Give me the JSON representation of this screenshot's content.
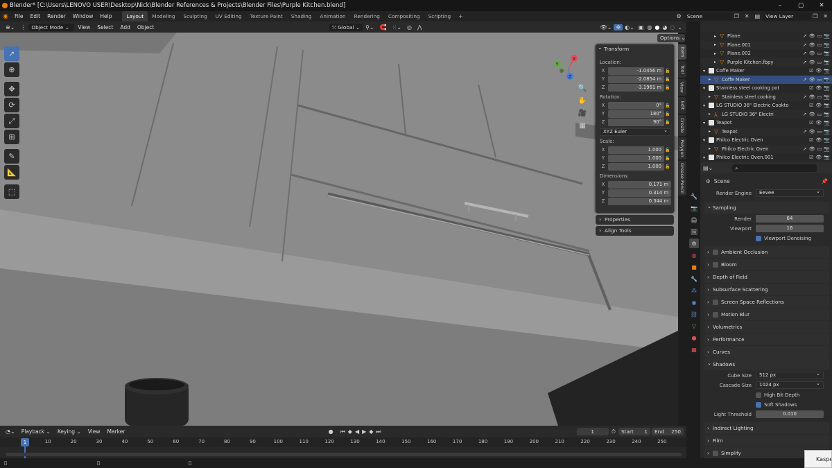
{
  "window": {
    "title": "Blender* [C:\\Users\\LENOVO USER\\Desktop\\Nick\\Blender References & Projects\\Blender Files\\Purple Kitchen.blend]"
  },
  "menu": {
    "items": [
      "File",
      "Edit",
      "Render",
      "Window",
      "Help"
    ]
  },
  "workspaces": [
    "Layout",
    "Modeling",
    "Sculpting",
    "UV Editing",
    "Texture Paint",
    "Shading",
    "Animation",
    "Rendering",
    "Compositing",
    "Scripting"
  ],
  "active_workspace": "Layout",
  "scene": {
    "name": "Scene",
    "view_layer": "View Layer"
  },
  "viewport_header": {
    "mode": "Object Mode",
    "menus": [
      "View",
      "Select",
      "Add",
      "Object"
    ],
    "orientation": "Global",
    "options": "Options"
  },
  "transform": {
    "title": "Transform",
    "location_label": "Location:",
    "location": {
      "x": "-1.0456 m",
      "y": "-2.0854 m",
      "z": "-3.1961 m"
    },
    "rotation_label": "Rotation:",
    "rotation": {
      "x": "0°",
      "y": "180°",
      "z": "90°"
    },
    "rotation_mode": "XYZ Euler",
    "scale_label": "Scale:",
    "scale": {
      "x": "1.000",
      "y": "1.000",
      "z": "1.000"
    },
    "dimensions_label": "Dimensions:",
    "dimensions": {
      "x": "0.171 m",
      "y": "0.314 m",
      "z": "0.344 m"
    },
    "axes": [
      "X",
      "Y",
      "Z"
    ]
  },
  "npanel_sections": [
    "Properties",
    "Align Tools"
  ],
  "side_tabs": [
    "Item",
    "Tool",
    "View",
    "Edit",
    "Create",
    "Polygon",
    "Grease Pencil"
  ],
  "outliner": {
    "rows": [
      {
        "label": "Plane",
        "indent": 2,
        "type": "mesh",
        "selected": false
      },
      {
        "label": "Plane.001",
        "indent": 2,
        "type": "mesh",
        "selected": false
      },
      {
        "label": "Plane.002",
        "indent": 2,
        "type": "mesh",
        "selected": false
      },
      {
        "label": "Purple Kitchen.fbpy",
        "indent": 2,
        "type": "mesh",
        "selected": false
      },
      {
        "label": "Coffe Maker",
        "indent": 0,
        "type": "collection",
        "selected": false
      },
      {
        "label": "Coffe Maker",
        "indent": 1,
        "type": "mesh",
        "selected": true
      },
      {
        "label": "Stainless steel cooking pot",
        "indent": 0,
        "type": "collection",
        "selected": false
      },
      {
        "label": "Stainless steel cooking",
        "indent": 1,
        "type": "mesh",
        "selected": false
      },
      {
        "label": "LG STUDIO 36\" Electric Cookto",
        "indent": 0,
        "type": "collection",
        "selected": false
      },
      {
        "label": "LG STUDIO 36\" Electri",
        "indent": 1,
        "type": "empty",
        "selected": false
      },
      {
        "label": "Teapot",
        "indent": 0,
        "type": "collection",
        "selected": false
      },
      {
        "label": "Teapot",
        "indent": 1,
        "type": "mesh",
        "selected": false
      },
      {
        "label": "Philco Electric Oven",
        "indent": 0,
        "type": "collection",
        "selected": false
      },
      {
        "label": "Philco Electric Oven",
        "indent": 1,
        "type": "mesh",
        "selected": false
      },
      {
        "label": "Philco Electric Oven.001",
        "indent": 0,
        "type": "collection",
        "selected": false
      }
    ]
  },
  "properties": {
    "context": "Scene",
    "render_engine_label": "Render Engine",
    "render_engine": "Eevee",
    "sampling": {
      "title": "Sampling",
      "render_label": "Render",
      "render": "64",
      "viewport_label": "Viewport",
      "viewport": "16",
      "denoise_label": "Viewport Denoising",
      "denoise_on": true
    },
    "sections_mid": [
      {
        "label": "Ambient Occlusion",
        "checkbox": true
      },
      {
        "label": "Bloom",
        "checkbox": true
      },
      {
        "label": "Depth of Field",
        "checkbox": false
      },
      {
        "label": "Subsurface Scattering",
        "checkbox": false
      },
      {
        "label": "Screen Space Reflections",
        "checkbox": true
      },
      {
        "label": "Motion Blur",
        "checkbox": true
      },
      {
        "label": "Volumetrics",
        "checkbox": false
      },
      {
        "label": "Performance",
        "checkbox": false
      },
      {
        "label": "Curves",
        "checkbox": false
      }
    ],
    "shadows": {
      "title": "Shadows",
      "cube_size_label": "Cube Size",
      "cube_size": "512 px",
      "cascade_size_label": "Cascade Size",
      "cascade_size": "1024 px",
      "high_bit_depth_label": "High Bit Depth",
      "high_bit_depth": false,
      "soft_shadows_label": "Soft Shadows",
      "soft_shadows": true,
      "light_threshold_label": "Light Threshold",
      "light_threshold": "0.010"
    },
    "sections_bottom": [
      {
        "label": "Indirect Lighting",
        "checkbox": false
      },
      {
        "label": "Film",
        "checkbox": false
      },
      {
        "label": "Simplify",
        "checkbox": true
      }
    ]
  },
  "timeline": {
    "menus": [
      "Playback",
      "Keying",
      "View",
      "Marker"
    ],
    "current_frame": "1",
    "start_label": "Start",
    "start": "1",
    "end_label": "End",
    "end": "250",
    "ticks": [
      "10",
      "20",
      "30",
      "40",
      "50",
      "60",
      "70",
      "80",
      "90",
      "100",
      "110",
      "120",
      "130",
      "140",
      "150",
      "160",
      "170",
      "180",
      "190",
      "200",
      "210",
      "220",
      "230",
      "240",
      "250"
    ],
    "playhead_label": "1"
  },
  "popup": {
    "text": "Kaspe"
  },
  "colors": {
    "accent": "#4772b3",
    "selection": "#334d80",
    "blender_orange": "#e87d0d",
    "viewport_bg": "#868686"
  }
}
